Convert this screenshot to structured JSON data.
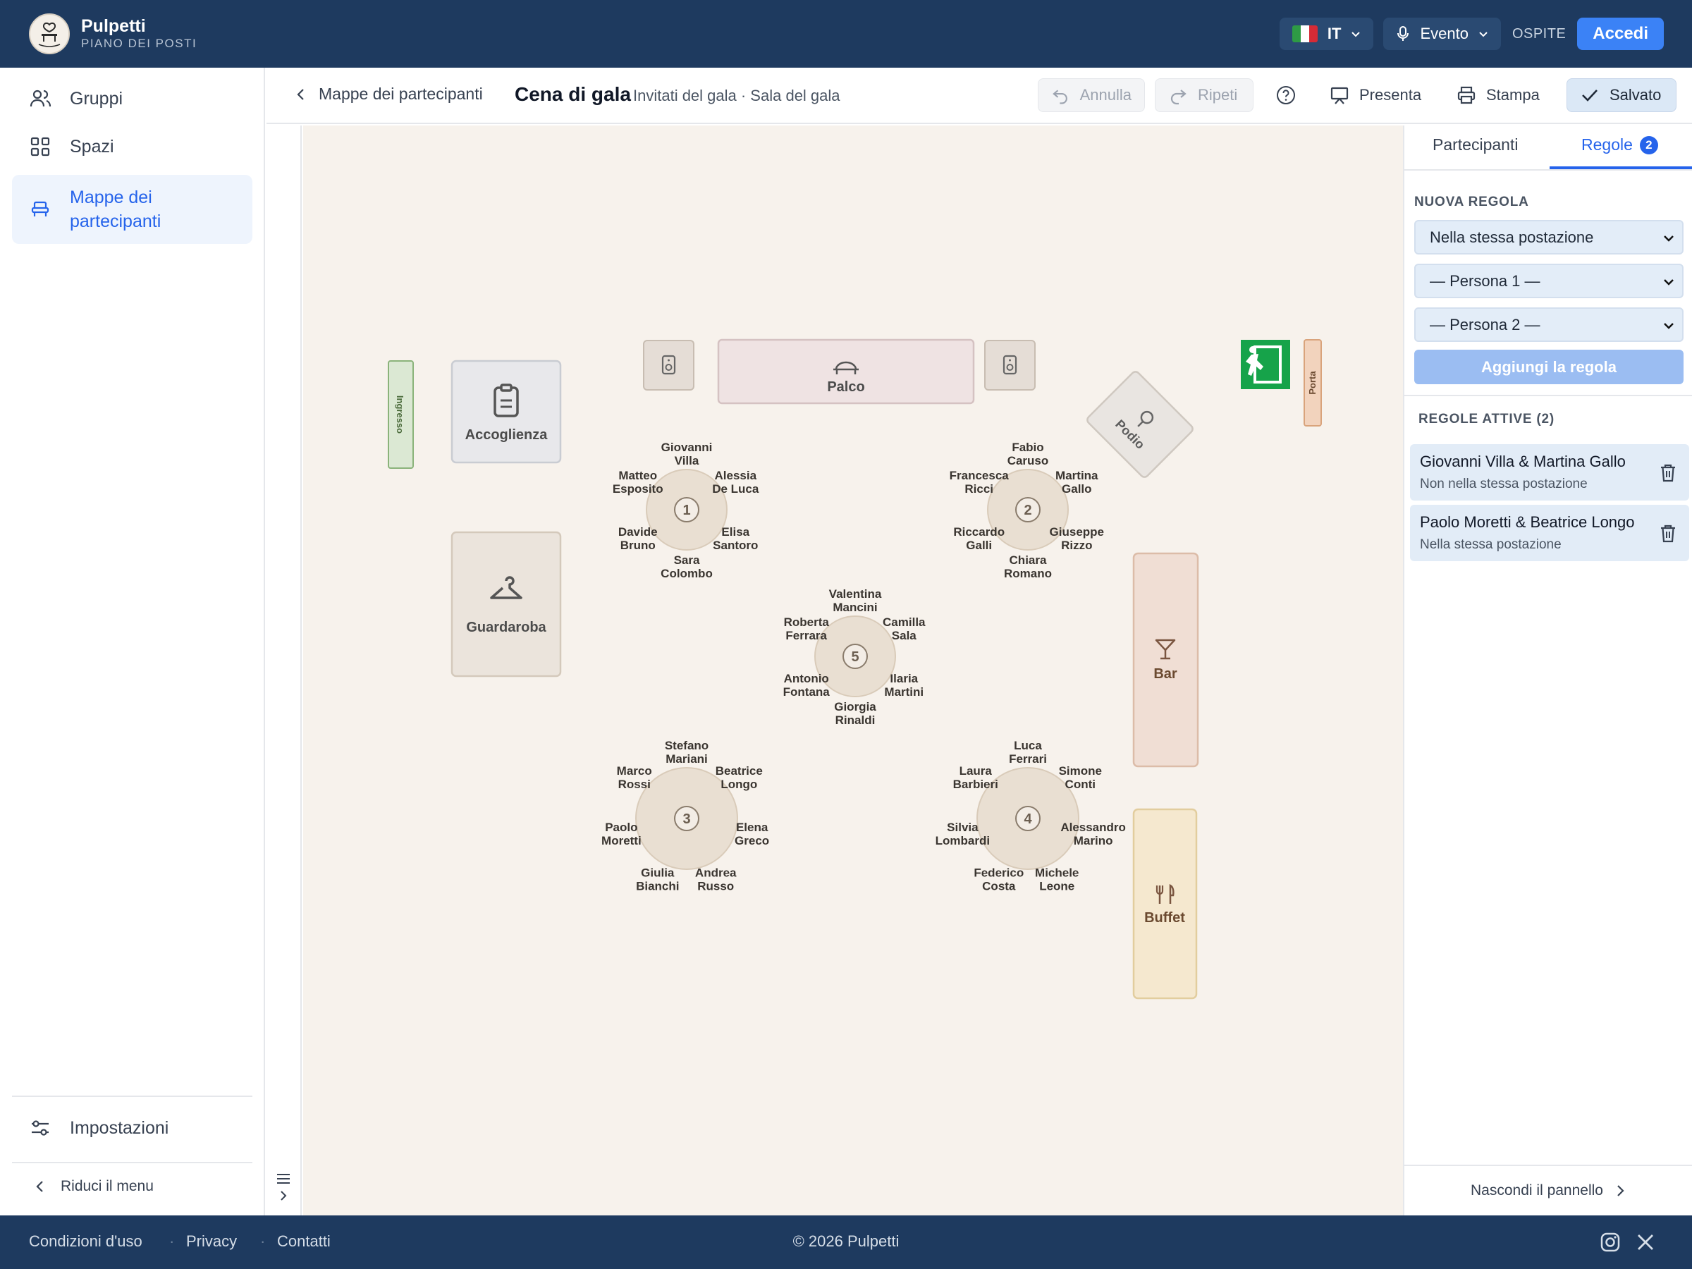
{
  "app": {
    "name": "Pulpetti",
    "subtitle": "PIANO DEI POSTI",
    "language": "IT",
    "mode": "Evento",
    "role": "OSPITE",
    "login_label": "Accedi"
  },
  "sidebar": {
    "items": [
      {
        "label": "Gruppi",
        "icon": "users-icon"
      },
      {
        "label": "Spazi",
        "icon": "grid-icon"
      },
      {
        "label": "Mappe dei partecipanti",
        "icon": "chair-icon",
        "active": true
      }
    ],
    "settings_label": "Impostazioni",
    "collapse_label": "Riduci il menu"
  },
  "subheader": {
    "back_label": "Mappe dei partecipanti",
    "title": "Cena di gala",
    "breadcrumb": "Invitati del gala · Sala del gala",
    "undo_label": "Annulla",
    "redo_label": "Ripeti",
    "present_label": "Presenta",
    "print_label": "Stampa",
    "saved_label": "Salvato"
  },
  "floorplan": {
    "fixtures": {
      "entrance": "Ingresso",
      "reception": "Accoglienza",
      "cloakroom": "Guardaroba",
      "stage": "Palco",
      "podium": "Podio",
      "door": "Porta",
      "bar": "Bar",
      "buffet": "Buffet"
    },
    "tables": [
      {
        "number": "1",
        "guests": [
          "Giovanni Villa",
          "Alessia De Luca",
          "Elisa Santoro",
          "Sara Colombo",
          "Davide Bruno",
          "Matteo Esposito"
        ]
      },
      {
        "number": "2",
        "guests": [
          "Fabio Caruso",
          "Martina Gallo",
          "Giuseppe Rizzo",
          "Chiara Romano",
          "Riccardo Galli",
          "Francesca Ricci"
        ]
      },
      {
        "number": "3",
        "guests": [
          "Stefano Mariani",
          "Beatrice Longo",
          "Elena Greco",
          "Andrea Russo",
          "Giulia Bianchi",
          "Paolo Moretti",
          "Marco Rossi"
        ]
      },
      {
        "number": "4",
        "guests": [
          "Luca Ferrari",
          "Simone Conti",
          "Alessandro Marino",
          "Michele Leone",
          "Federico Costa",
          "Silvia Lombardi",
          "Laura Barbieri"
        ]
      },
      {
        "number": "5",
        "guests": [
          "Valentina Mancini",
          "Camilla Sala",
          "Ilaria Martini",
          "Giorgia Rinaldi",
          "Antonio Fontana",
          "Roberta Ferrara"
        ]
      }
    ]
  },
  "panel": {
    "tabs": [
      "Partecipanti",
      "Regole"
    ],
    "rules_count": "2",
    "new_rule_label": "NUOVA REGOLA",
    "rule_type": "Nella stessa postazione",
    "person1_placeholder": "— Persona 1 —",
    "person2_placeholder": "— Persona 2 —",
    "add_rule_label": "Aggiungi la regola",
    "active_rules_label": "REGOLE ATTIVE (2)",
    "rules": [
      {
        "people": "Giovanni Villa & Martina Gallo",
        "type": "Non nella stessa postazione"
      },
      {
        "people": "Paolo Moretti & Beatrice Longo",
        "type": "Nella stessa postazione"
      }
    ],
    "hide_label": "Nascondi il pannello"
  },
  "footer": {
    "links": [
      "Condizioni d'uso",
      "Privacy",
      "Contatti"
    ],
    "copyright": "© 2026 Pulpetti"
  },
  "colors": {
    "header": "#1e3a5f",
    "accent": "#2563eb",
    "canvas": "#f7f2ec",
    "table_fill": "#e9dfd2",
    "exit_sign": "#16a34a"
  }
}
